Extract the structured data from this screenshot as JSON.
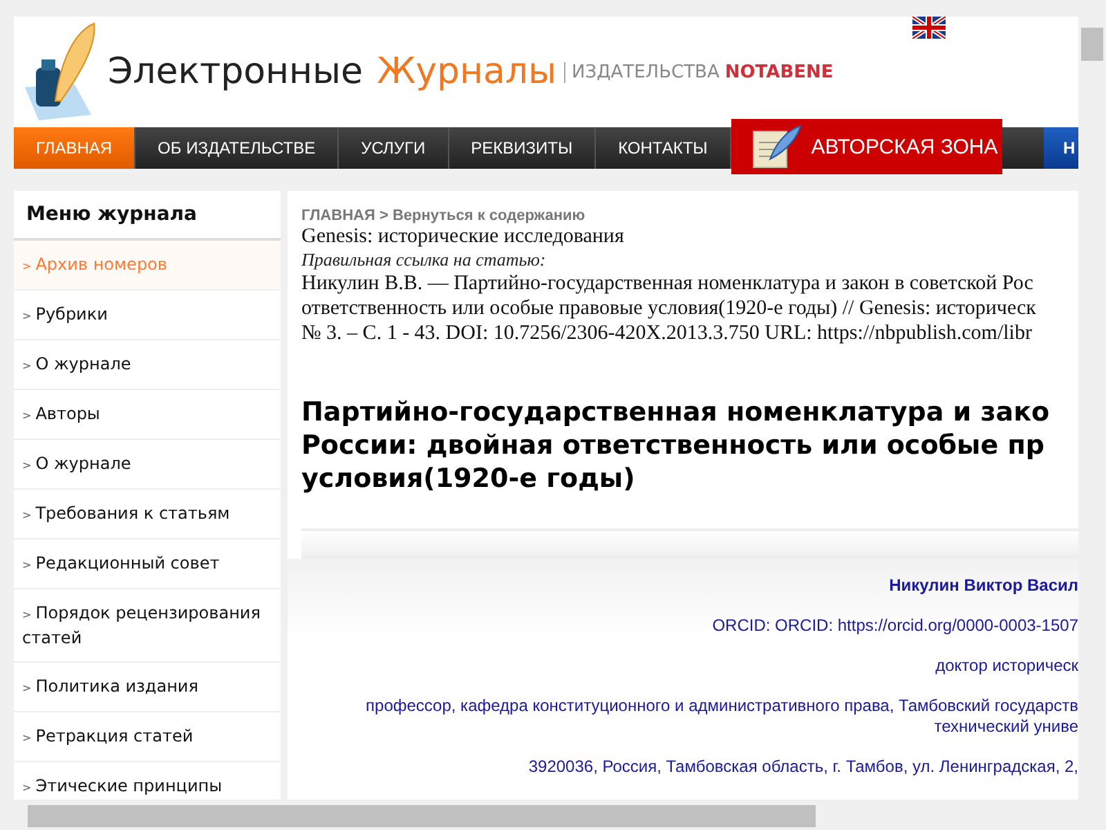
{
  "header": {
    "logo_word_1": "Электронные",
    "logo_word_2": "Журналы",
    "publisher_prefix": "ИЗДАТЕЛЬСТВА",
    "publisher_name": "NOTABENE"
  },
  "nav": {
    "tabs": [
      {
        "label": "ГЛАВНАЯ",
        "selected": true
      },
      {
        "label": "ОБ ИЗДАТЕЛЬСТВЕ",
        "selected": false
      },
      {
        "label": "УСЛУГИ",
        "selected": false
      },
      {
        "label": "РЕКВИЗИТЫ",
        "selected": false
      },
      {
        "label": "КОНТАКТЫ",
        "selected": false
      }
    ],
    "author_zone": "АВТОРСКАЯ ЗОНА",
    "edge_tab": "Н"
  },
  "sidebar": {
    "title": "Меню журнала",
    "items": [
      {
        "marker": ">",
        "label": "Архив номеров",
        "selected": true
      },
      {
        "marker": ">",
        "label": "Рубрики",
        "selected": false
      },
      {
        "marker": ">",
        "label": "О журнале",
        "selected": false
      },
      {
        "marker": ">",
        "label": "Авторы",
        "selected": false
      },
      {
        "marker": ">",
        "label": "О журнале",
        "selected": false
      },
      {
        "marker": ">",
        "label": "Требования к статьям",
        "selected": false
      },
      {
        "marker": ">",
        "label": "Редакционный совет",
        "selected": false
      },
      {
        "marker": ">",
        "label": "Порядок рецензирования статей",
        "selected": false
      },
      {
        "marker": ">",
        "label": "Политика издания",
        "selected": false
      },
      {
        "marker": ">",
        "label": "Ретракция статей",
        "selected": false
      },
      {
        "marker": ">",
        "label": "Этические принципы",
        "selected": false
      }
    ]
  },
  "breadcrumb": {
    "home": "ГЛАВНАЯ",
    "separator": ">",
    "back": "Вернуться к содержанию"
  },
  "journal": "Genesis: исторические исследования",
  "citation_label": "Правильная ссылка на статью:",
  "citation_lines": [
    "Никулин В.В. — Партийно-государственная номенклатура и закон в советской Рос",
    "ответственность или особые правовые условия(1920-е годы) // Genesis: историческ",
    "№ 3. – С. 1 - 43. DOI: 10.7256/2306-420X.2013.3.750 URL: https://nbpublish.com/libr"
  ],
  "title_lines": [
    "Партийно-государственная номенклатура и зако",
    "России: двойная ответственность или особые пр",
    "условия(1920-е годы)"
  ],
  "author": {
    "name": "Никулин Виктор Васил",
    "orcid": "ORCID: ORCID: https://orcid.org/0000-0003-1507",
    "degree": "доктор историческ",
    "position_lines": [
      "профессор, кафедра конституционного и административного права, Тамбовский государств",
      "технический униве"
    ],
    "address": "3920036, Россия, Тамбовская область, г. Тамбов, ул. Ленинградская, 2,"
  }
}
